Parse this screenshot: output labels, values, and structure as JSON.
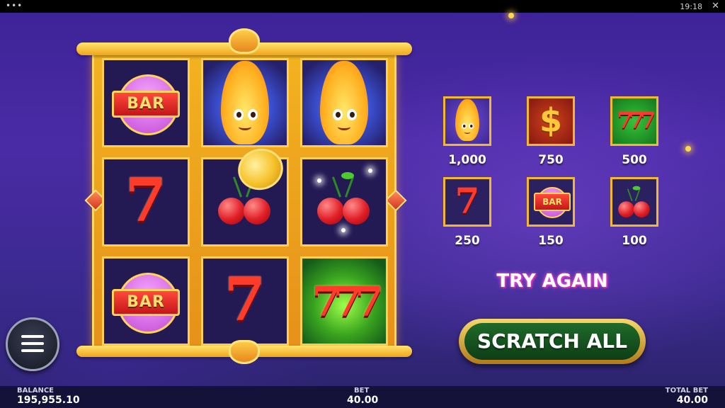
{
  "status_bar": {
    "time": "19:18",
    "dots": "•••",
    "close": "✕"
  },
  "board": {
    "cells": [
      {
        "symbol": "BAR"
      },
      {
        "symbol": "flame"
      },
      {
        "symbol": "flame"
      },
      {
        "symbol": "7"
      },
      {
        "symbol": "cherry"
      },
      {
        "symbol": "cherry"
      },
      {
        "symbol": "BAR"
      },
      {
        "symbol": "7"
      },
      {
        "symbol": "777"
      }
    ]
  },
  "symbols": {
    "bar_text": "BAR",
    "seven_text": "7",
    "triple_seven_text": "777",
    "dollar_text": "$"
  },
  "paytable": [
    {
      "symbol": "flame",
      "value": "1,000"
    },
    {
      "symbol": "dollar",
      "value": "750"
    },
    {
      "symbol": "777",
      "value": "500"
    },
    {
      "symbol": "7",
      "value": "250"
    },
    {
      "symbol": "BAR",
      "value": "150"
    },
    {
      "symbol": "cherry",
      "value": "100"
    }
  ],
  "result_text": "TRY AGAIN",
  "scratch_button_label": "SCRATCH ALL",
  "footer": {
    "balance_label": "BALANCE",
    "balance_value": "195,955.10",
    "bet_label": "BET",
    "bet_value": "40.00",
    "total_bet_label": "TOTAL BET",
    "total_bet_value": "40.00"
  },
  "colors": {
    "accent_gold": "#f2b928",
    "button_green": "#1f6b2a",
    "result_pink": "#ff5cf0"
  }
}
